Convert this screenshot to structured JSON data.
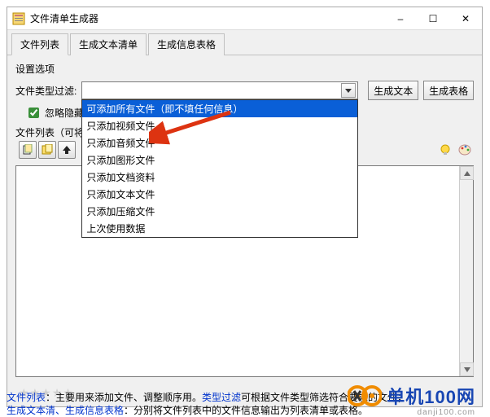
{
  "window": {
    "title": "文件清单生成器"
  },
  "win_controls": {
    "min": "–",
    "max": "☐",
    "close": "✕"
  },
  "tabs": [
    "文件列表",
    "生成文本清单",
    "生成信息表格"
  ],
  "section_label": "设置选项",
  "filter_label": "文件类型过滤:",
  "checkbox_label": "忽略隐藏",
  "btn_text": "生成文本",
  "btn_table": "生成表格",
  "dropdown_items": [
    "可添加所有文件（即不填任何信息）",
    "只添加视频文件",
    "只添加音频文件",
    "只添加图形文件",
    "只添加文档资料",
    "只添加文本文件",
    "只添加压缩文件",
    "上次使用数据"
  ],
  "list_label_prefix": "文件列表（可将",
  "footer": {
    "l1a": "文件列表",
    "l1b": "：主要用来添加文件、调整顺序用。",
    "l1c": "类型过滤",
    "l1d": "可根据文件类型筛选符合要求的文件；",
    "l2a": "生成文本清、生成信息表格",
    "l2b": "：分别将文件列表中的文件信息输出为列表清单或表格。"
  },
  "watermark": {
    "brand": "单机100网",
    "url": "danji100.com"
  }
}
